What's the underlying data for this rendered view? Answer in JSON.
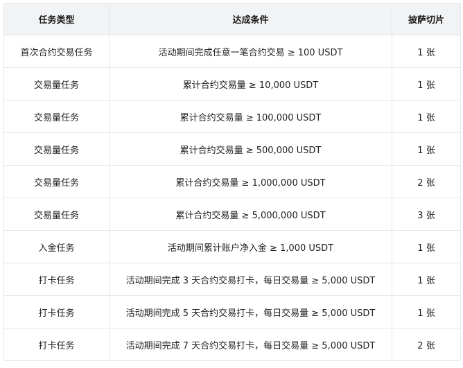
{
  "table": {
    "headers": [
      "任务类型",
      "达成条件",
      "披萨切片"
    ],
    "rows": [
      [
        "首次合约交易任务",
        "活动期间完成任意一笔合约交易 ≥ 100 USDT",
        "1 张"
      ],
      [
        "交易量任务",
        "累计合约交易量 ≥ 10,000 USDT",
        "1 张"
      ],
      [
        "交易量任务",
        "累计合约交易量 ≥ 100,000 USDT",
        "1 张"
      ],
      [
        "交易量任务",
        "累计合约交易量 ≥ 500,000 USDT",
        "1 张"
      ],
      [
        "交易量任务",
        "累计合约交易量 ≥ 1,000,000 USDT",
        "2 张"
      ],
      [
        "交易量任务",
        "累计合约交易量 ≥ 5,000,000 USDT",
        "3 张"
      ],
      [
        "入金任务",
        "活动期间累计账户净入金 ≥ 1,000 USDT",
        "1 张"
      ],
      [
        "打卡任务",
        "活动期间完成 3 天合约交易打卡，每日交易量 ≥ 5,000 USDT",
        "1 张"
      ],
      [
        "打卡任务",
        "活动期间完成 5 天合约交易打卡，每日交易量 ≥ 5,000 USDT",
        "1 张"
      ],
      [
        "打卡任务",
        "活动期间完成 7 天合约交易打卡，每日交易量 ≥ 5,000 USDT",
        "2 张"
      ]
    ]
  }
}
